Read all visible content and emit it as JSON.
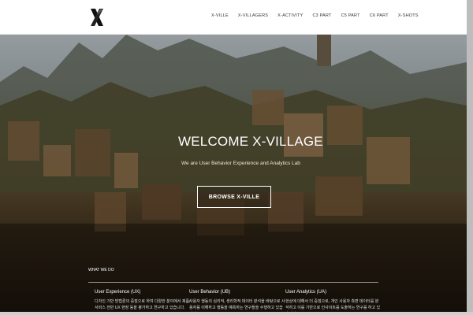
{
  "nav": {
    "items": [
      "X-VILLE",
      "X-VILLAGERS",
      "X-ACTIVITY",
      "C3 PART",
      "C5 PART",
      "C6 PART",
      "X-SHOTS"
    ]
  },
  "hero": {
    "title": "WELCOME X-VILLAGE",
    "subtitle": "We are User Behavior Experience and Analytics Lab",
    "button_label": "BROWSE X-VILLE"
  },
  "section": {
    "label": "WHAT WE DO"
  },
  "features": [
    {
      "title": "User Experience (UX)",
      "text": "디자인 기반 방법론의 중점으로 하여 다양한 분야에서 제품/서비스 전반 UX 현장 등을 평가하고 연구하고 있습니다."
    },
    {
      "title": "User Behavior (UB)",
      "text": "사용자 행동의 심리적, 생리학적 데이터 분석을 바탕으로 사용자를 이해하고 행동을 예측하는 연구들을 수행하고 있습니다."
    },
    {
      "title": "User Analytics (UA)",
      "text": "현상에 대해서 더 중점으로, 개인 사용자 측면 데이터를 분석하고 이를 기반으로 인사이트를 도출하는 연구를 하고 있습니다."
    }
  ],
  "colors": {
    "nav_bg": "#ffffff",
    "hero_text": "#ffffff"
  }
}
